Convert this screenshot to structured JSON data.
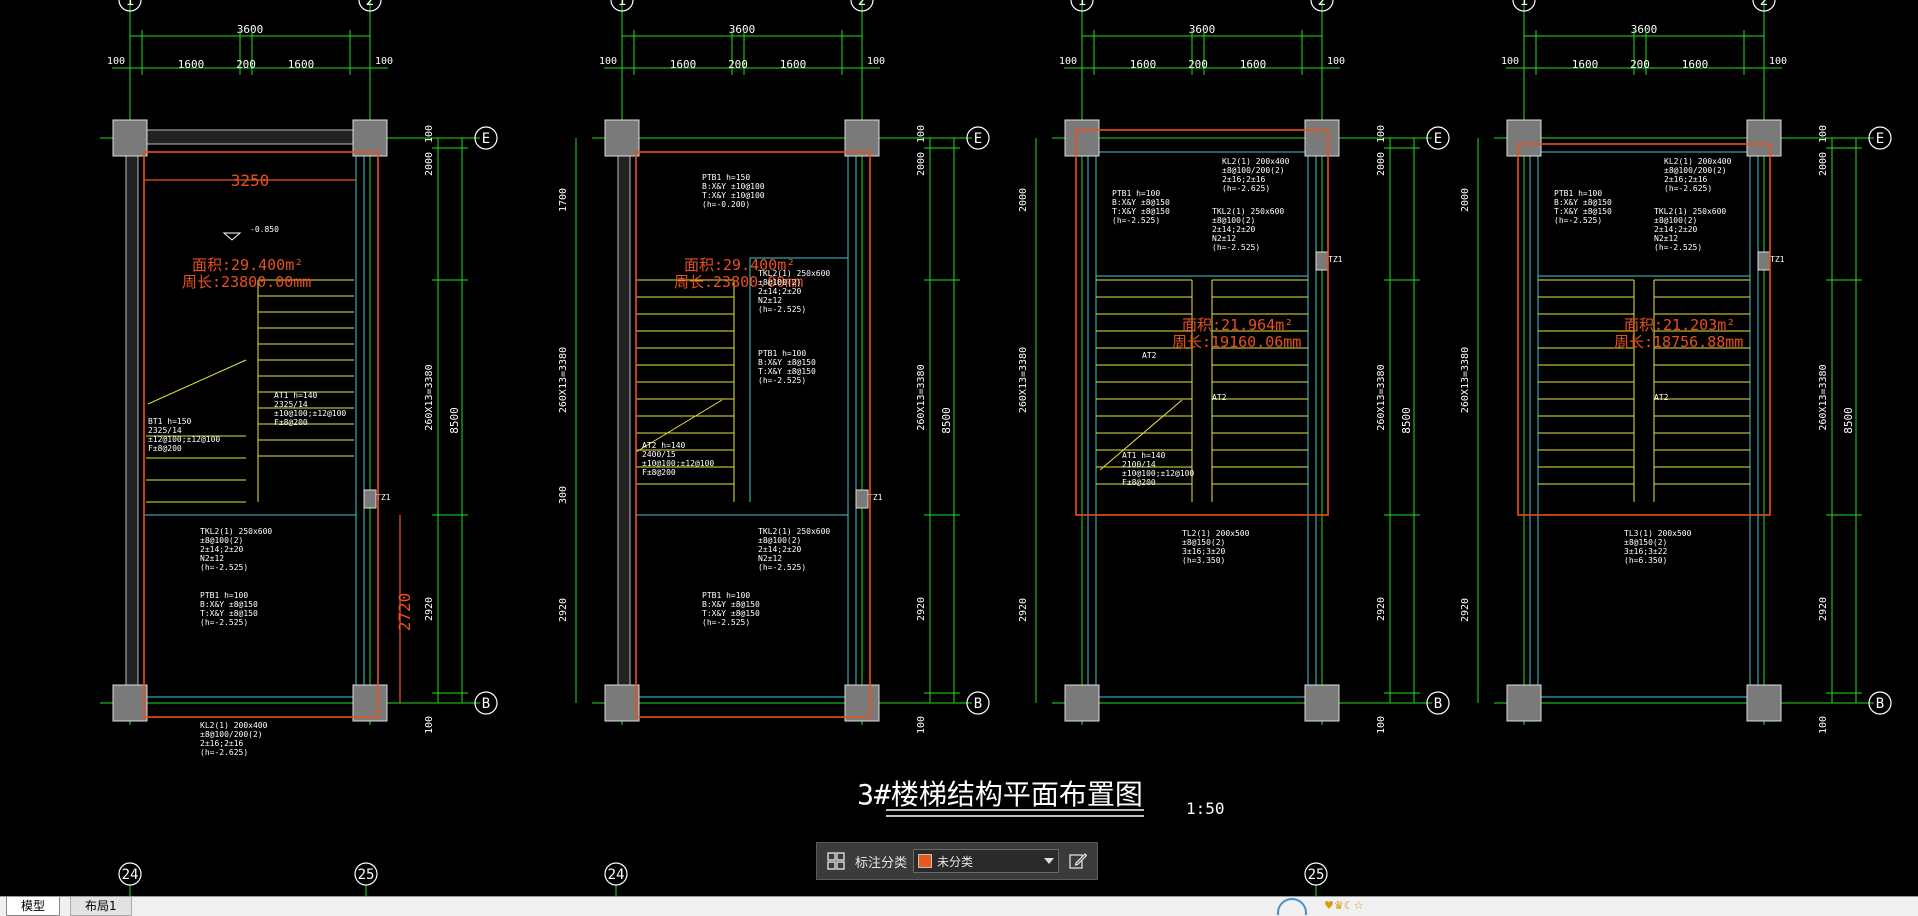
{
  "drawing": {
    "axis_labels": {
      "left": "1",
      "right": "2",
      "top_row": "E",
      "bottom_row": "B",
      "bottom_left": "24",
      "bottom_right": "25"
    },
    "dims": {
      "top_total": "3600",
      "top_left": "1600",
      "top_mid": "200",
      "top_right": "1600",
      "edge": "100",
      "right_total": "8500",
      "right_top": "2000",
      "right_mid": "260X13=3380",
      "right_bottom": "2920",
      "left_top": "1700",
      "left_mid": "260X13=3380",
      "left_lower": "300",
      "left_bottom": "2920",
      "inner_width": "3250",
      "inner_height": "2720"
    },
    "areas": [
      {
        "area": "面积:29.400m²",
        "perimeter": "周长:23800.00mm"
      },
      {
        "area": "面积:29.400m²",
        "perimeter": "周长:23800.00mm"
      },
      {
        "area": "面积:21.964m²",
        "perimeter": "周长:19160.06mm"
      },
      {
        "area": "面积:21.203m²",
        "perimeter": "周长:18756.88mm"
      }
    ],
    "title": "3#楼梯结构平面布置图",
    "scale": "1:50",
    "annotations": {
      "level": "-0.850",
      "pt1": [
        "BT1 h=150",
        "2325/14",
        "±12@100;±12@100",
        "F±8@200"
      ],
      "at1": [
        "AT1 h=140",
        "2325/14",
        "±10@100;±12@100",
        "F±8@200"
      ],
      "tkl": [
        "TKL2(1) 250x600",
        "±8@100(2)",
        "2±14;2±20",
        "N2±12",
        "(h=-2.525)"
      ],
      "ptb": [
        "PTB1 h=100",
        "B:X&Y ±8@150",
        "T:X&Y ±8@150",
        "(h=-2.525)"
      ],
      "kl": [
        "KL2(1) 200x400",
        "±8@100/200(2)",
        "2±16;2±16",
        "(h=-2.625)"
      ],
      "tz": "TZ1",
      "pt2": [
        "PTB1 h=150",
        "B:X&Y ±10@100",
        "T:X&Y ±10@100",
        "(h=-0.200)"
      ],
      "at2": [
        "AT2 h=140",
        "2400/15",
        "±10@100;±12@100",
        "F±8@200"
      ],
      "tl": [
        "TL2(1) 200x500",
        "±8@150(2)",
        "3±16;3±20",
        "(h=3.350)"
      ],
      "tl3": [
        "TL3(1) 200x500",
        "±8@150(2)",
        "3±16;3±22",
        "(h=6.350)"
      ],
      "at2_label": "AT2",
      "at1b": [
        "AT1 h=140",
        "2100/14",
        "±10@100;±12@100",
        "F±8@200"
      ]
    }
  },
  "toolbar": {
    "label": "标注分类",
    "selected": "未分类",
    "swatch_color": "#e85a1c"
  },
  "tabs": {
    "model": "模型",
    "layout1": "布局1"
  },
  "colors": {
    "background": "#000000",
    "dim": "#22dd22",
    "boundary": "#e8501e",
    "wall": "#3fc6d6",
    "stair": "#e6e43a",
    "text": "#ffffff",
    "column": "#7a7a7a"
  }
}
